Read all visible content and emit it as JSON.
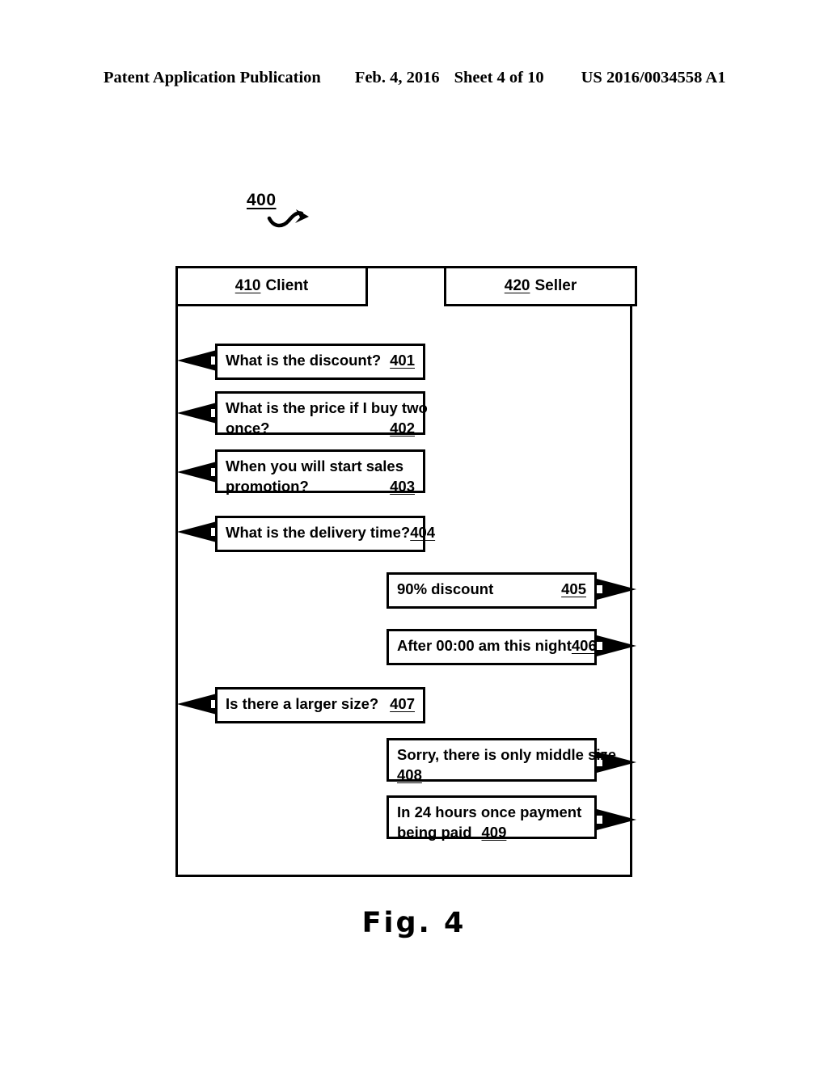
{
  "page_header": {
    "publication": "Patent Application Publication",
    "date": "Feb. 4, 2016",
    "sheet": "Sheet 4 of 10",
    "patent_number": "US 2016/0034558 A1"
  },
  "figure": {
    "tag": "400",
    "caption": "Fig. 4",
    "arrow_icon": "curved-arrow-icon"
  },
  "columns": {
    "client": {
      "refnum": "410",
      "label": "Client"
    },
    "seller": {
      "refnum": "420",
      "label": "Seller"
    }
  },
  "messages": [
    {
      "refnum": "401",
      "side": "client",
      "lines": [
        "What is the discount?"
      ],
      "layout": "single-line-number-right"
    },
    {
      "refnum": "402",
      "side": "client",
      "lines": [
        "What is the price if I  buy two",
        "once?"
      ],
      "layout": "two-line-number-right"
    },
    {
      "refnum": "403",
      "side": "client",
      "lines": [
        "When you will start sales",
        "promotion?"
      ],
      "layout": "two-line-number-right"
    },
    {
      "refnum": "404",
      "side": "client",
      "lines": [
        "What is the delivery time?"
      ],
      "layout": "single-line-number-right"
    },
    {
      "refnum": "405",
      "side": "seller",
      "lines": [
        "90% discount"
      ],
      "layout": "single-line-number-right"
    },
    {
      "refnum": "406",
      "side": "seller",
      "lines": [
        "After 00:00 am this night"
      ],
      "layout": "single-line-number-right"
    },
    {
      "refnum": "407",
      "side": "client",
      "lines": [
        "Is there a larger size?"
      ],
      "layout": "single-line-number-right"
    },
    {
      "refnum": "408",
      "side": "seller",
      "lines": [
        "Sorry, there is only middle size",
        ""
      ],
      "layout": "two-line-number-left"
    },
    {
      "refnum": "409",
      "side": "seller",
      "lines": [
        "In 24 hours once payment",
        "being paid"
      ],
      "layout": "two-line-number-inline"
    }
  ],
  "colors": {
    "ink": "#000000",
    "paper": "#ffffff"
  }
}
